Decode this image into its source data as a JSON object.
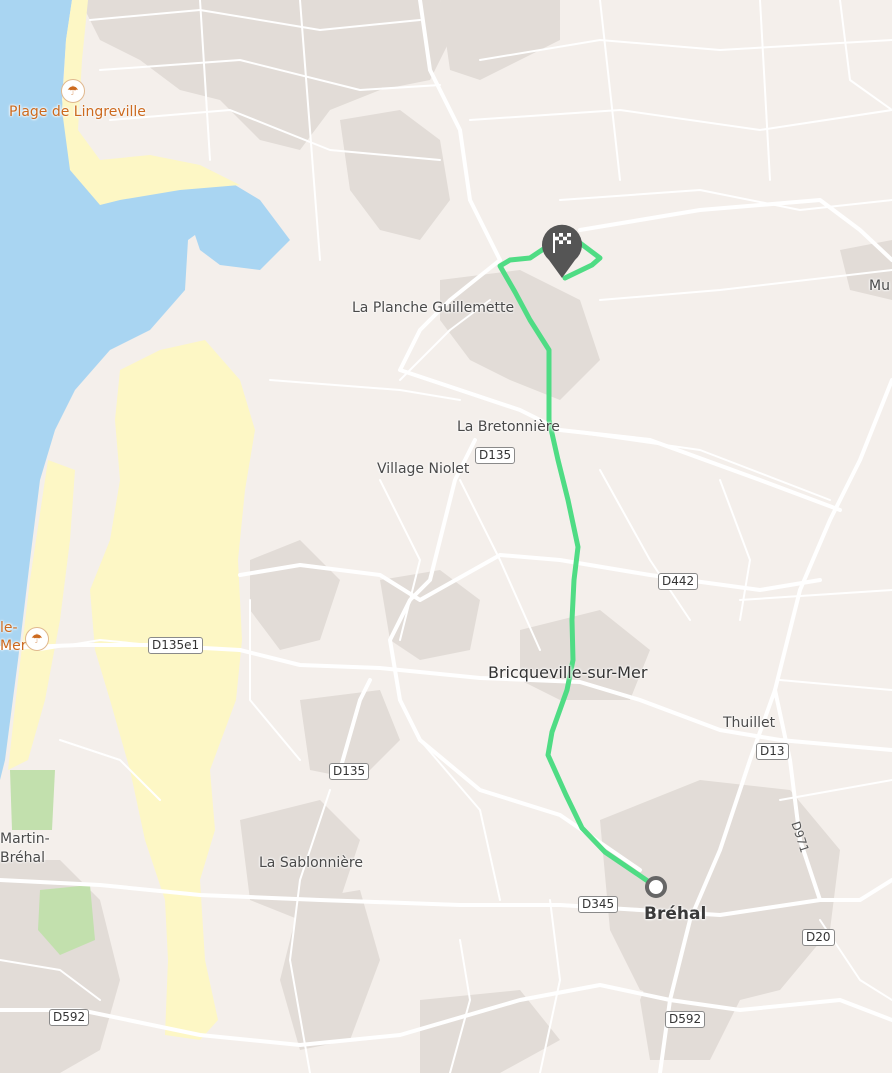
{
  "map": {
    "places": {
      "plage_lingreville": "Plage de Lingreville",
      "planche_guillemette": "La Planche Guillemette",
      "bretonniere": "La Bretonnière",
      "village_niolet": "Village Niolet",
      "bricqueville": "Bricqueville-sur-Mer",
      "thuillet": "Thuillet",
      "sablonniere": "La Sablonnière",
      "brehal": "Bréhal",
      "martin_brehal_1": "Martin-",
      "martin_brehal_2": "Bréhal",
      "edge_le": "le-",
      "edge_mer": "Mer",
      "edge_mu": "Mu"
    },
    "roads": {
      "d135_a": "D135",
      "d135_b": "D135",
      "d442": "D442",
      "d135e1": "D135e1",
      "d13": "D13",
      "d971": "D971",
      "d345": "D345",
      "d20": "D20",
      "d592_a": "D592",
      "d592_b": "D592"
    },
    "icons": {
      "beach": "beach-umbrella-icon",
      "finish": "checkered-flag-icon",
      "start": "start-circle-icon"
    },
    "colors": {
      "route": "#4fdc84",
      "water": "#a9d5f2",
      "sand": "#fdf7c5",
      "land": "#f4efeb",
      "built": "#dcd6d1",
      "park": "#c2e0ad",
      "marker": "#555555"
    }
  }
}
